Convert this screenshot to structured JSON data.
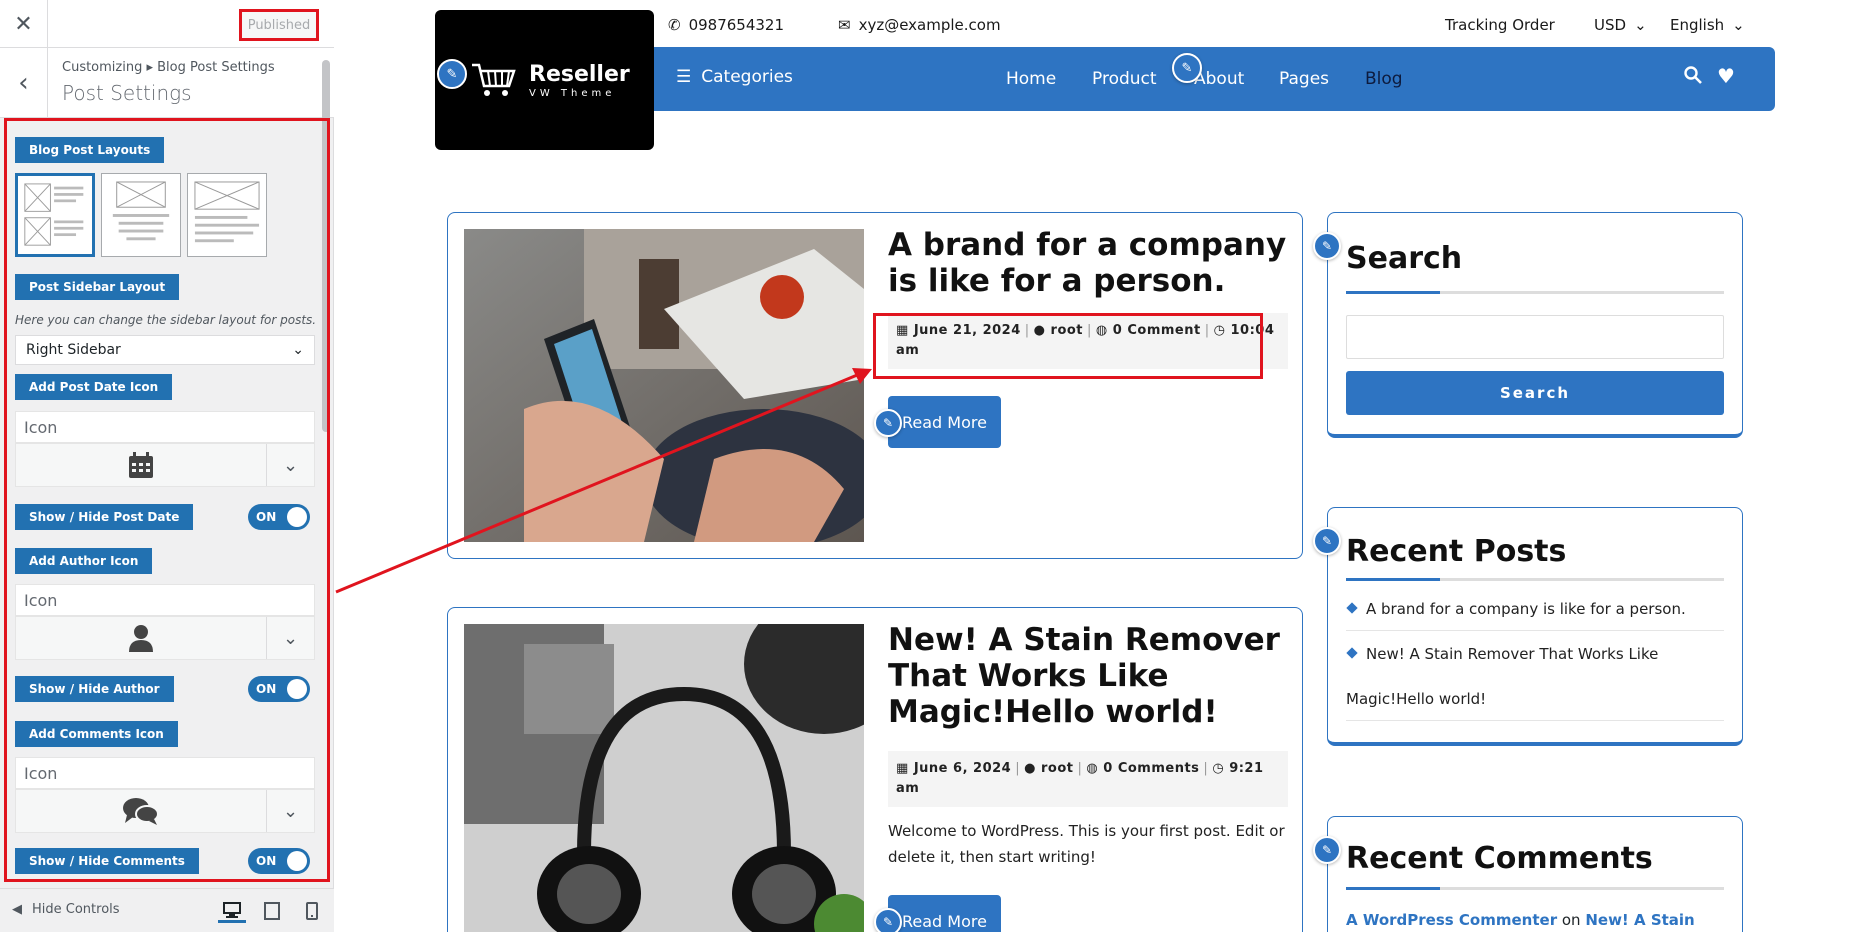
{
  "customizer": {
    "close_icon": "close-icon",
    "published_label": "Published",
    "breadcrumb": "Customizing ▸ Blog Post Settings",
    "title": "Post Settings",
    "blog_post_layouts_label": "Blog Post Layouts",
    "post_sidebar_layout_label": "Post Sidebar Layout",
    "sidebar_help": "Here you can change the sidebar layout for posts.",
    "sidebar_select_value": "Right Sidebar",
    "add_post_date_icon_label": "Add Post Date Icon",
    "icon_placeholder": "Icon",
    "show_hide_post_date_label": "Show / Hide Post Date",
    "add_author_icon_label": "Add Author Icon",
    "show_hide_author_label": "Show / Hide Author",
    "add_comments_icon_label": "Add Comments Icon",
    "show_hide_comments_label": "Show / Hide Comments",
    "toggle_on": "ON",
    "hide_controls_label": "Hide Controls"
  },
  "site": {
    "phone": "0987654321",
    "email": "xyz@example.com",
    "tracking": "Tracking Order",
    "currency": "USD",
    "language": "English",
    "brand": "Reseller",
    "tagline": "VW Theme",
    "categories_label": "Categories",
    "nav": [
      "Home",
      "Product",
      "About",
      "Pages",
      "Blog"
    ],
    "accent_color": "#2e74c2"
  },
  "posts": [
    {
      "title": "A brand for a company is like for a person.",
      "date": "June 21, 2024",
      "author": "root",
      "comments": "0 Comment",
      "time": "10:04 am",
      "read_more": "Read More"
    },
    {
      "title": "New! A Stain Remover That Works Like Magic!Hello world!",
      "date": "June 6, 2024",
      "author": "root",
      "comments": "0 Comments",
      "time": "9:21 am",
      "excerpt": "Welcome to WordPress. This is your first post. Edit or delete it, then start writing!",
      "read_more": "Read More"
    }
  ],
  "widgets": {
    "search_title": "Search",
    "search_button": "Search",
    "recent_posts_title": "Recent Posts",
    "recent_posts": [
      "A brand for a company is like for a person.",
      "New! A Stain Remover That Works Like",
      "Magic!Hello world!"
    ],
    "recent_comments_title": "Recent Comments",
    "comment_author": "A WordPress Commenter",
    "comment_on": "on",
    "comment_post": "New! A Stain"
  }
}
